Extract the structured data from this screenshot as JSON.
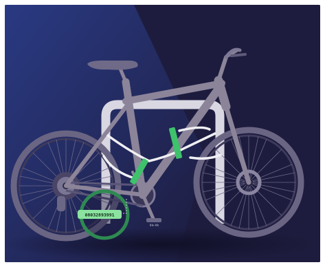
{
  "illustration": {
    "subject": "bicycle locked to a bike rack",
    "serial_number_tag": "08032893991",
    "pedal_mark": "ꝛꝛ-ꝛꝛ",
    "colors": {
      "background": "#1d1c3e",
      "spotlight": "#2b3d8a",
      "frame": "#8c8499",
      "rack": "#d9d7e2",
      "cable": "#f0f0f4",
      "lock_green": "#3ec26b",
      "highlight_ring": "#2f8a52"
    }
  }
}
